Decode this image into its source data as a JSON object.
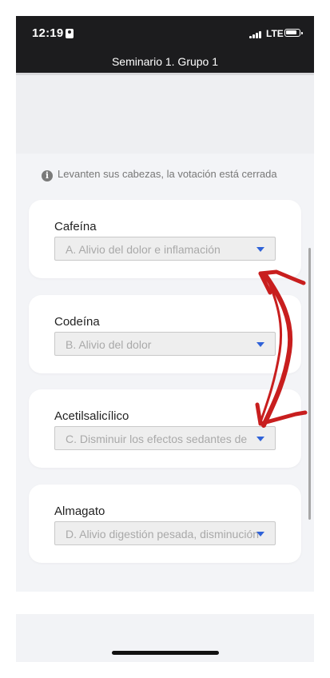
{
  "status_bar": {
    "time": "12:19",
    "network": "LTE"
  },
  "header": {
    "title": "Seminario 1. Grupo 1"
  },
  "notice": {
    "icon": "info-icon",
    "text": "Levanten sus cabezas, la votación está cerrada"
  },
  "questions": [
    {
      "label": "Cafeína",
      "selected": "A. Alivio del dolor e inflamación"
    },
    {
      "label": "Codeína",
      "selected": "B. Alivio del dolor"
    },
    {
      "label": "Acetilsalicílico",
      "selected": "C. Disminuir los efectos sedantes de"
    },
    {
      "label": "Almagato",
      "selected": "D. Alivio digestión pesada, disminución"
    }
  ],
  "colors": {
    "caret": "#2f62d8",
    "annotation_arrow": "#c81e1e"
  }
}
